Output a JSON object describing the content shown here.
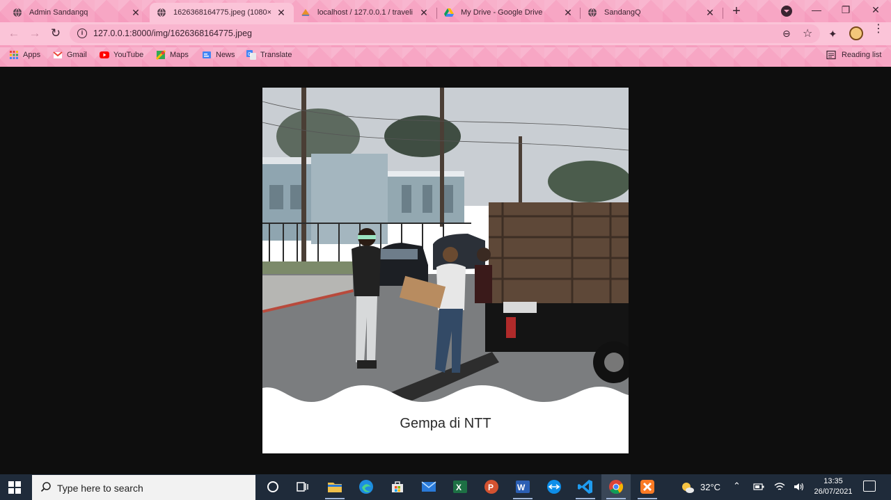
{
  "tabs": [
    {
      "title": "Admin Sandangq",
      "active": false
    },
    {
      "title": "1626368164775.jpeg (1080×",
      "active": true
    },
    {
      "title": "localhost / 127.0.0.1 / traveli",
      "active": false
    },
    {
      "title": "My Drive - Google Drive",
      "active": false
    },
    {
      "title": "SandangQ",
      "active": false
    }
  ],
  "address": {
    "url": "127.0.0.1:8000/img/1626368164775.jpeg"
  },
  "bookmarks": [
    {
      "label": "Apps"
    },
    {
      "label": "Gmail"
    },
    {
      "label": "YouTube"
    },
    {
      "label": "Maps"
    },
    {
      "label": "News"
    },
    {
      "label": "Translate"
    }
  ],
  "reading_list": "Reading list",
  "card": {
    "caption": "Gempa di NTT"
  },
  "taskbar": {
    "search_placeholder": "Type here to search",
    "weather": "32°C",
    "time": "13:35",
    "date": "26/07/2021"
  },
  "colors": {
    "chrome_pink": "#f7a6c4",
    "page_bg": "#0e0e0e",
    "taskbar": "#1f2b3a"
  }
}
